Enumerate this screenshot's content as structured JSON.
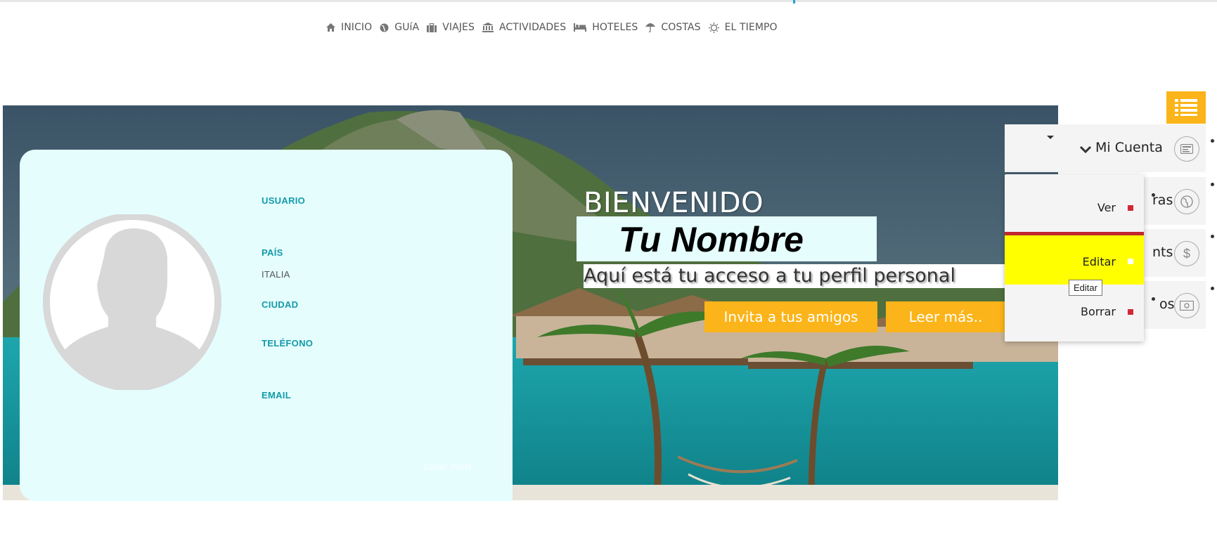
{
  "nav": {
    "items": [
      {
        "label": "INICIO",
        "icon": "home-icon"
      },
      {
        "label": "GUíA",
        "icon": "globe-icon"
      },
      {
        "label": "VIAJES",
        "icon": "suitcase-icon"
      },
      {
        "label": "ACTIVIDADES",
        "icon": "bank-icon"
      },
      {
        "label": "HOTELES",
        "icon": "bed-icon"
      },
      {
        "label": "COSTAS",
        "icon": "umbrella-icon"
      },
      {
        "label": "EL TIEMPO",
        "icon": "sun-icon"
      }
    ]
  },
  "profile": {
    "user_label": "USUARIO",
    "country_label": "PAÍS",
    "country_value": "ITALIA",
    "city_label": "CIUDAD",
    "phone_label": "TELÉFONO",
    "email_label": "EMAIL",
    "edit_link": "Editar Perfil"
  },
  "hero": {
    "welcome": "BIENVENIDO",
    "name": "Tu Nombre",
    "subtitle": "Aquí está tu acceso a tu perfil personal",
    "invite_button": "Invita a tus amigos",
    "readmore_button": "Leer más.."
  },
  "sidebar": {
    "account": "Mi Cuenta",
    "item2_label": "ras",
    "item3_label": "nts",
    "item4_label": "os"
  },
  "dropdown": {
    "ver": "Ver",
    "editar": "Editar",
    "borrar": "Borrar",
    "tooltip": "Editar"
  },
  "colors": {
    "accent": "#fbb419",
    "label_teal": "#139aaa",
    "card_bg": "#e5fdfd",
    "active_yellow": "#ffff00",
    "active_border": "#c0282d",
    "dot_red": "#d0283a"
  }
}
